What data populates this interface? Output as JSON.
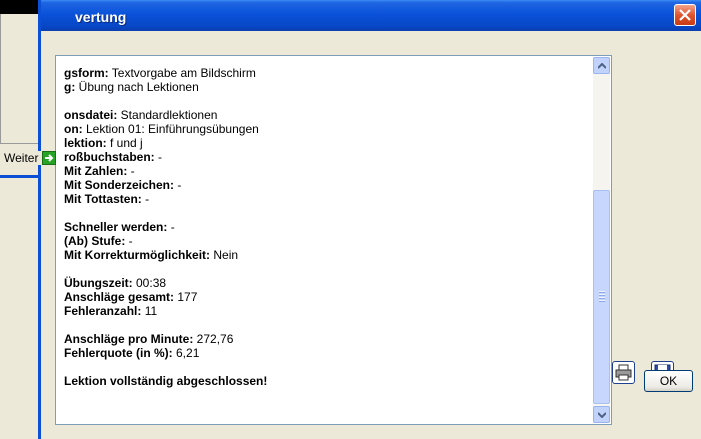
{
  "window": {
    "title": "vertung"
  },
  "background_window": {
    "next_label": "Weiter"
  },
  "report": {
    "rows": [
      {
        "label": "gsform:",
        "value": " Textvorgabe am Bildschirm"
      },
      {
        "label": "g:",
        "value": " Übung nach Lektionen"
      },
      {
        "blank": true
      },
      {
        "label": "onsdatei:",
        "value": " Standardlektionen"
      },
      {
        "label": "on:",
        "value": " Lektion 01: Einführungsübungen"
      },
      {
        "label": "lektion:",
        "value": " f und j"
      },
      {
        "label": "roßbuchstaben:",
        "value": " -"
      },
      {
        "label": "Mit Zahlen:",
        "value": " -"
      },
      {
        "label": "Mit Sonderzeichen:",
        "value": " -"
      },
      {
        "label": "Mit Tottasten:",
        "value": " -"
      },
      {
        "blank": true
      },
      {
        "label": "Schneller werden:",
        "value": " -"
      },
      {
        "label": "(Ab) Stufe:",
        "value": " -"
      },
      {
        "label": "Mit Korrekturmöglichkeit:",
        "value": " Nein"
      },
      {
        "blank": true
      },
      {
        "label": "Übungszeit:",
        "value": " 00:38"
      },
      {
        "label": "Anschläge gesamt:",
        "value": " 177"
      },
      {
        "label": "Fehleranzahl:",
        "value": " 11"
      },
      {
        "blank": true
      },
      {
        "label": "Anschläge pro Minute:",
        "value": " 272,76"
      },
      {
        "label": "Fehlerquote (in %):",
        "value": " 6,21"
      },
      {
        "blank": true
      },
      {
        "label": "Lektion vollständig abgeschlossen!",
        "value": ""
      }
    ],
    "scroll_position": 0.55
  },
  "buttons": {
    "ok_label": "OK"
  },
  "icons": {
    "print": "printer-icon",
    "save": "floppy-disk-icon",
    "close": "close-icon",
    "next": "green-arrow-right-icon"
  }
}
